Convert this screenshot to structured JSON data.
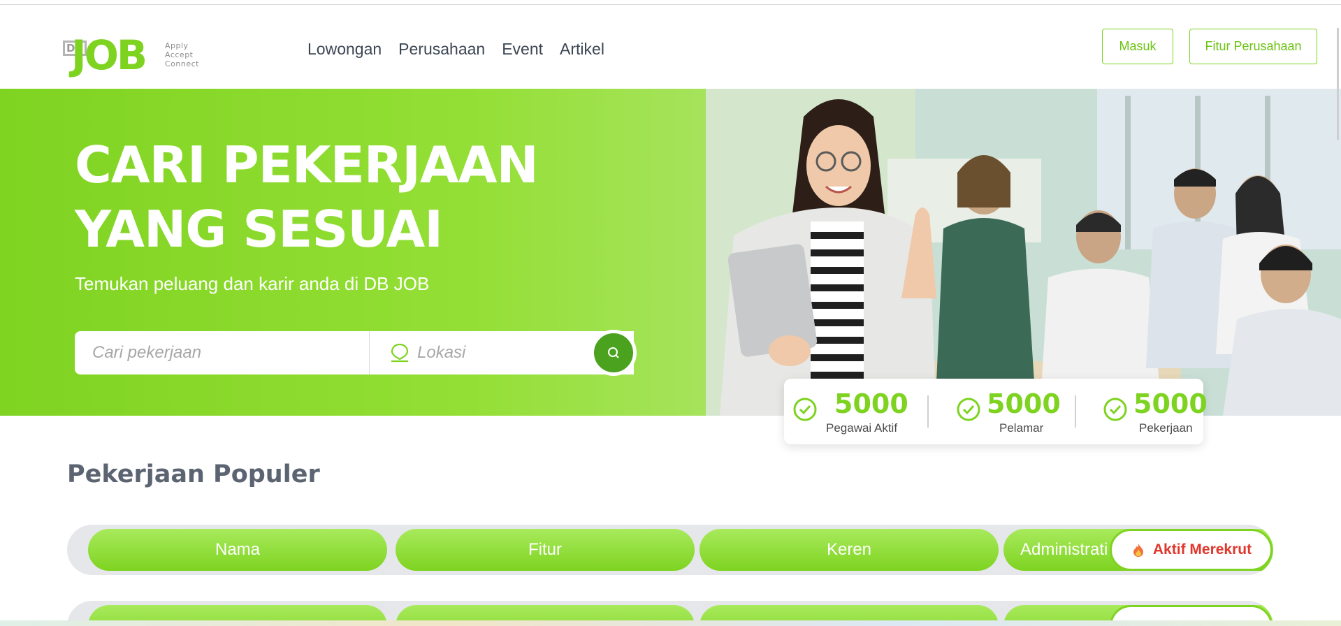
{
  "brand": {
    "logo_db": "DB",
    "logo_job": "JOB",
    "logo_tagline": [
      "Apply",
      "Accept",
      "Connect"
    ]
  },
  "nav": {
    "items": [
      "Lowongan",
      "Perusahaan",
      "Event",
      "Artikel"
    ],
    "login_label": "Masuk",
    "company_features_label": "Fitur Perusahaan"
  },
  "hero": {
    "title_line1": "CARI PEKERJAAN",
    "title_line2": "YANG SESUAI",
    "subtitle": "Temukan peluang dan karir anda di DB JOB",
    "search_placeholder": "Cari pekerjaan",
    "location_placeholder": "Lokasi"
  },
  "stats": [
    {
      "value": "5000",
      "label": "Pegawai Aktif"
    },
    {
      "value": "5000",
      "label": "Pelamar"
    },
    {
      "value": "5000",
      "label": "Pekerjaan"
    }
  ],
  "popular": {
    "title": "Pekerjaan Populer",
    "row1": [
      "Nama",
      "Fitur",
      "Keren",
      "Administrati"
    ],
    "hiring_badge": "Aktif Merekrut"
  },
  "colors": {
    "brand_green": "#7ed321",
    "hiring_red": "#e0362b"
  }
}
